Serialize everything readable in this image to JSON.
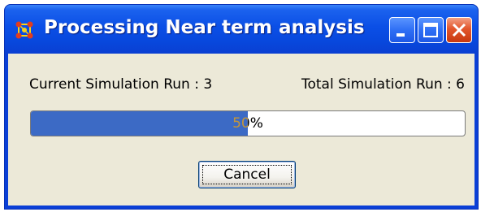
{
  "window": {
    "title": "Processing Near term analysis",
    "icon": "network-icon",
    "controls": {
      "minimize_icon": "minimize-icon",
      "maximize_icon": "maximize-icon",
      "close_icon": "close-icon"
    }
  },
  "status": {
    "current_run_label": "Current Simulation Run : 3",
    "total_run_label": "Total Simulation Run : 6"
  },
  "progress": {
    "value": 0.5,
    "text": "50%"
  },
  "actions": {
    "cancel_label": "Cancel"
  },
  "colors": {
    "titlebar": "#0a4fe6",
    "dialog_bg": "#ece9d8",
    "progress_fill": "#3c6ac5",
    "close_button": "#e2562c"
  }
}
